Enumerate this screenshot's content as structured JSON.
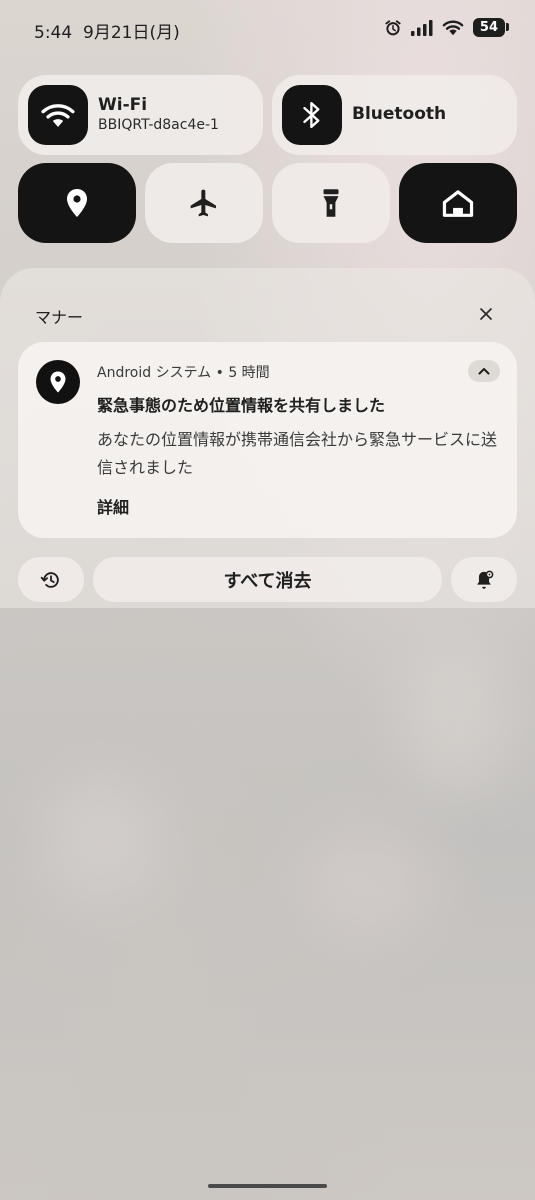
{
  "status_bar": {
    "time": "5:44",
    "date": "9月21日(月)",
    "battery": "54",
    "icons": [
      "alarm-icon",
      "signal-icon",
      "wifi-icon",
      "battery-icon"
    ]
  },
  "quick_settings": {
    "wifi": {
      "title": "Wi-Fi",
      "subtitle": "BBIQRT-d8ac4e-1",
      "icon": "wifi-icon"
    },
    "bluetooth": {
      "title": "Bluetooth",
      "icon": "bluetooth-icon"
    },
    "round_tiles": [
      {
        "name": "location",
        "icon": "location-pin-icon",
        "active": true
      },
      {
        "name": "airplane",
        "icon": "airplane-icon",
        "active": false
      },
      {
        "name": "flashlight",
        "icon": "flashlight-icon",
        "active": false
      },
      {
        "name": "home",
        "icon": "home-icon",
        "active": true
      }
    ]
  },
  "notifications": {
    "section_label": "マナー",
    "close_icon": "close-icon",
    "items": [
      {
        "app_meta": "Android システム • 5 時間",
        "title": "緊急事態のため位置情報を共有しました",
        "body": "あなたの位置情報が携帯通信会社から緊急サービスに送信されました",
        "action": "詳細",
        "icon": "location-pin-icon"
      }
    ],
    "clear_all": "すべて消去",
    "history_icon": "history-icon",
    "settings_icon": "notification-settings-icon"
  },
  "colors": {
    "tile_active": "#141414",
    "tile_inactive": "#f0ece9",
    "text": "#1f1f1f"
  }
}
